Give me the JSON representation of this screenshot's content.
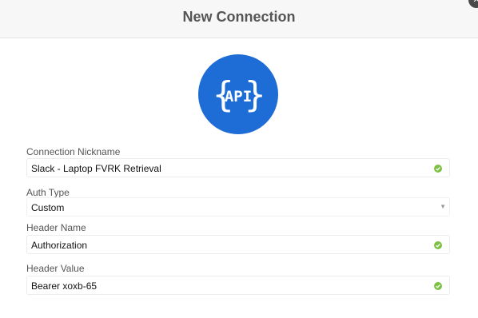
{
  "dialog": {
    "title": "New Connection",
    "logo_text": "API",
    "logo_color": "#1e6cd5"
  },
  "form": {
    "nickname": {
      "label": "Connection Nickname",
      "value": "Slack - Laptop FVRK Retrieval",
      "icon": "valid-check-icon"
    },
    "auth_type": {
      "label": "Auth Type",
      "value": "Custom",
      "icon": "dropdown-caret-icon"
    },
    "header_name": {
      "label": "Header Name",
      "value": "Authorization",
      "icon": "valid-check-icon"
    },
    "header_value": {
      "label": "Header Value",
      "value": "Bearer xoxb-65",
      "icon": "valid-check-icon"
    }
  },
  "colors": {
    "valid": "#7cc143",
    "header_bg": "#f7f7f7"
  }
}
